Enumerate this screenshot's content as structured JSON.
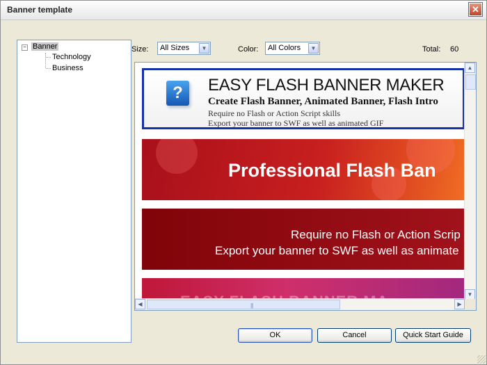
{
  "window": {
    "title": "Banner template",
    "close_glyph": "✕"
  },
  "tree": {
    "root": {
      "label": "Banner",
      "expanded_glyph": "−"
    },
    "children": [
      {
        "label": "Technology"
      },
      {
        "label": "Business"
      }
    ]
  },
  "filters": {
    "size": {
      "label": "Size:",
      "value": "All Sizes"
    },
    "color": {
      "label": "Color:",
      "value": "All Colors"
    },
    "total": {
      "label": "Total:",
      "value": "60"
    }
  },
  "banners": [
    {
      "headline": "EASY FLASH BANNER MAKER",
      "subline": "Create Flash Banner, Animated Banner, Flash Intro",
      "line1": "Require no Flash or Action Script skills",
      "line2": "Export your banner to SWF as well as animated GIF",
      "icon": "question-icon",
      "icon_glyph": "?"
    },
    {
      "headline": "Professional Flash Ban"
    },
    {
      "line1": "Require no Flash or Action Scrip",
      "line2": "Export your banner to SWF as well as animate"
    },
    {
      "ghost": "EASY FLASH BANNER MA"
    }
  ],
  "buttons": {
    "ok": "OK",
    "cancel": "Cancel",
    "guide": "Quick Start Guide"
  },
  "scroll": {
    "up": "▲",
    "down": "▼",
    "left": "◀",
    "right": "▶",
    "grip": "|||"
  },
  "dropdown_glyph": "▼",
  "colors": {
    "selection_border": "#1431a8",
    "banner_red": "#c81f1f",
    "banner_dark_red": "#800409"
  }
}
